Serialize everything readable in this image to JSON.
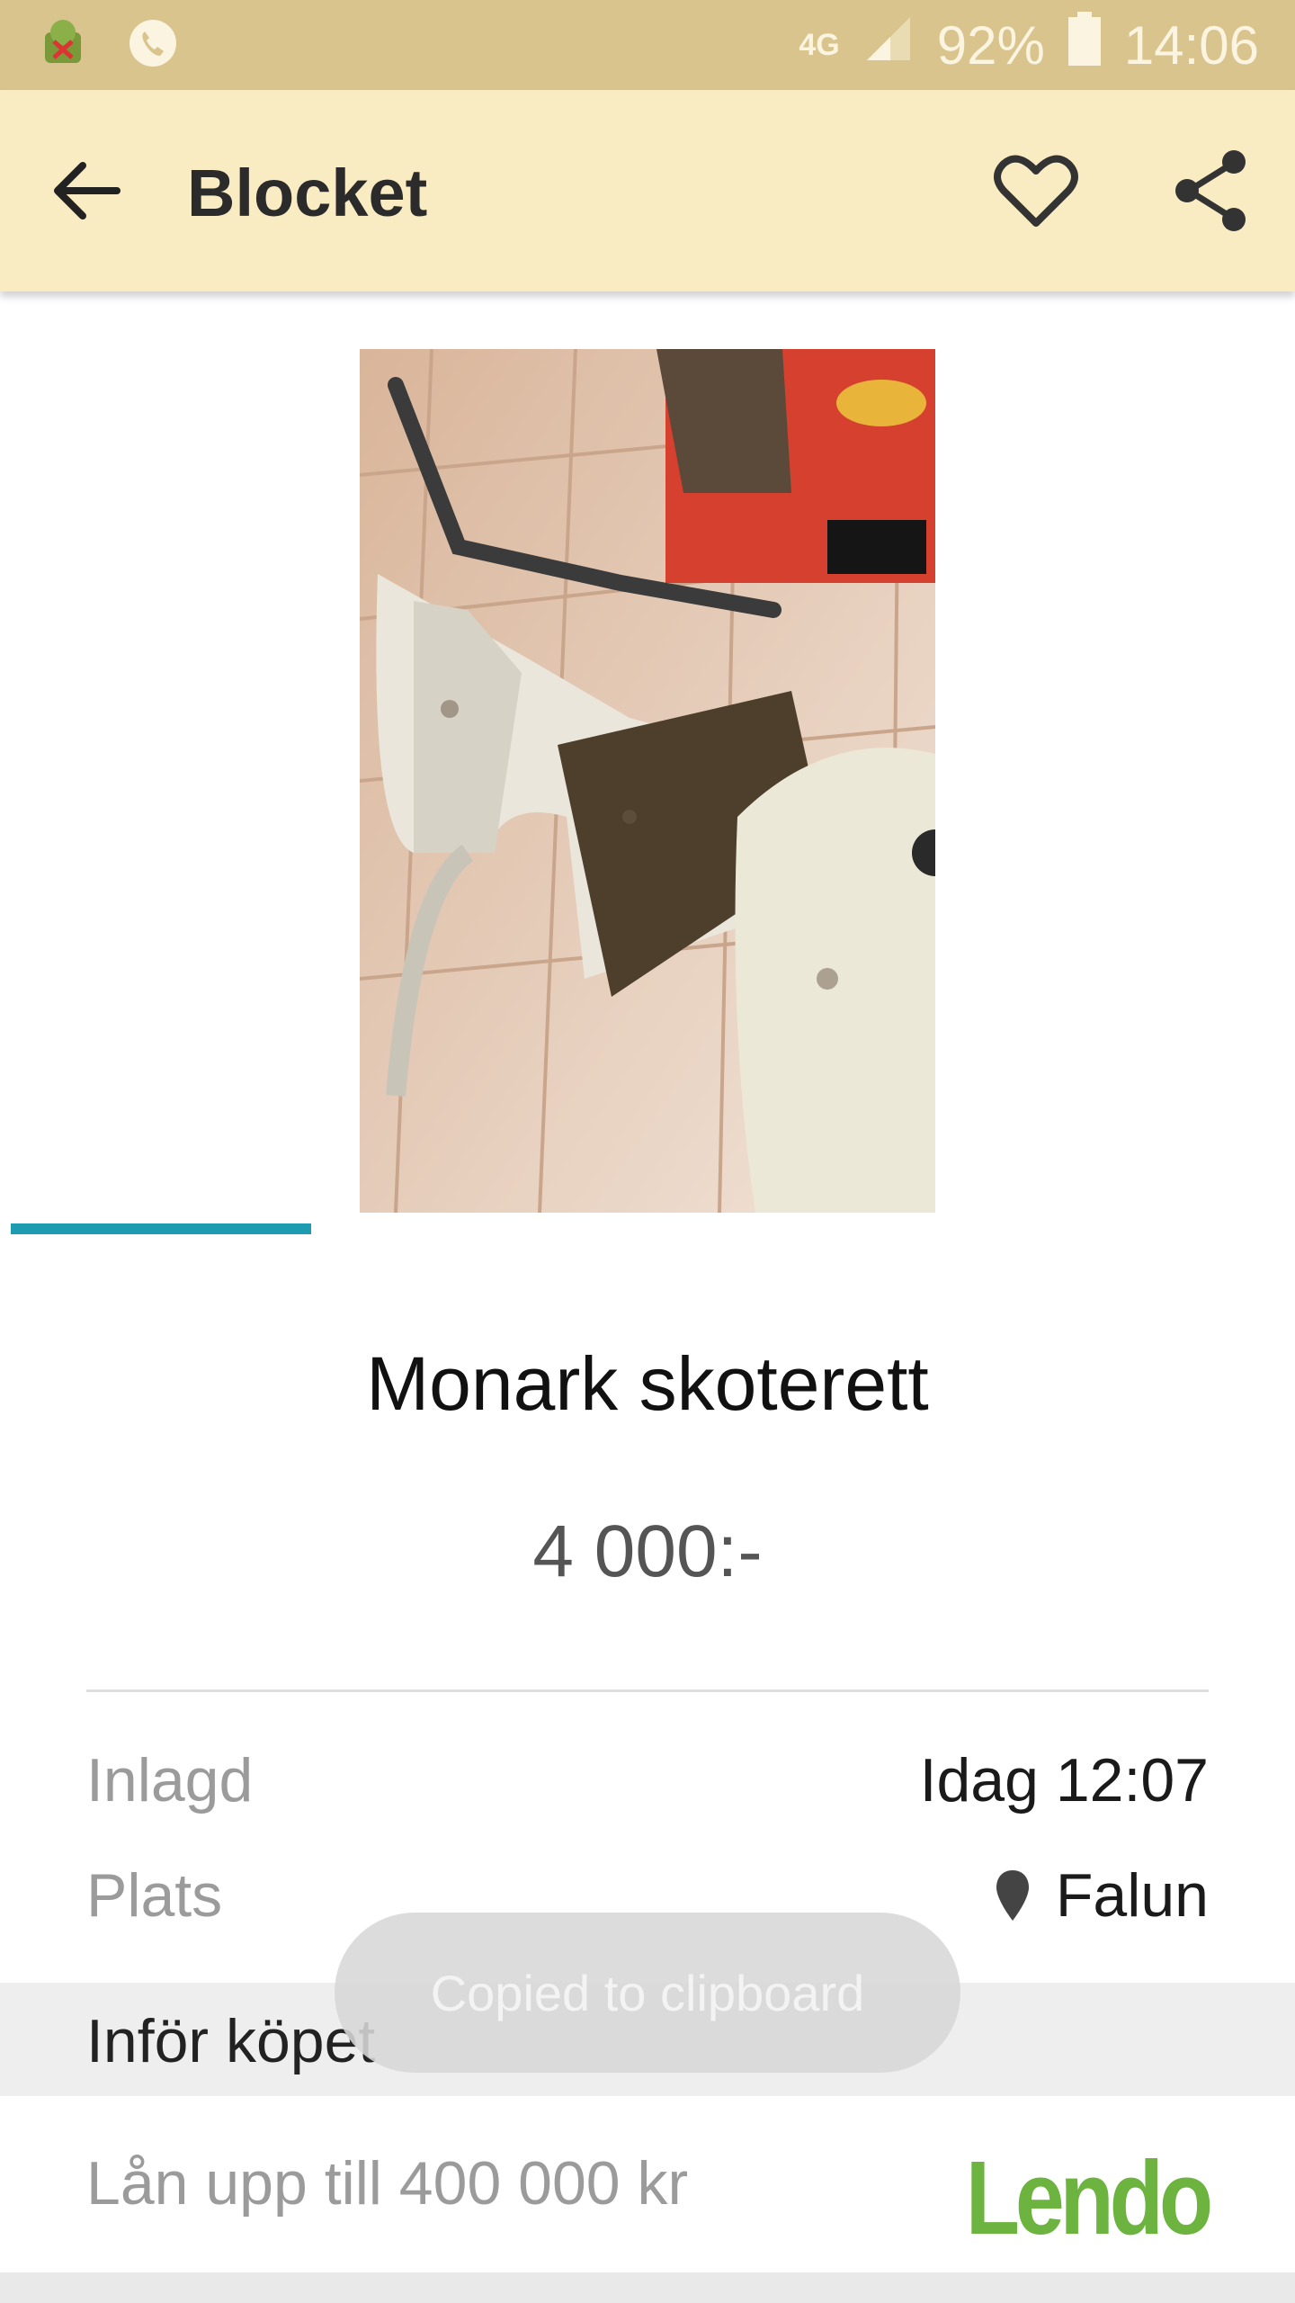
{
  "status_bar": {
    "network": "4G",
    "battery": "92%",
    "time": "14:06",
    "icons": [
      "android-debug-icon",
      "phone-call-icon",
      "signal-icon",
      "battery-icon"
    ]
  },
  "app_bar": {
    "title": "Blocket",
    "icons": [
      "back-arrow-icon",
      "heart-outline-icon",
      "share-icon"
    ]
  },
  "gallery": {
    "image_alt": "Monark skoterett photo",
    "active_page": 1
  },
  "ad": {
    "title": "Monark skoterett",
    "price": "4 000:-"
  },
  "details": [
    {
      "key": "Inlagd",
      "value": "Idag 12:07"
    },
    {
      "key": "Plats",
      "value": "Falun"
    }
  ],
  "section": {
    "label": "Inför köpet"
  },
  "loan": {
    "text": "Lån upp till 400 000 kr",
    "brand": "Lendo"
  },
  "toast": {
    "message": "Copied to clipboard"
  },
  "colors": {
    "status_bar": "#d8c48c",
    "app_bar": "#f9ebc2",
    "indicator": "#1d9bb0",
    "lendo_green": "#6cb33f"
  }
}
